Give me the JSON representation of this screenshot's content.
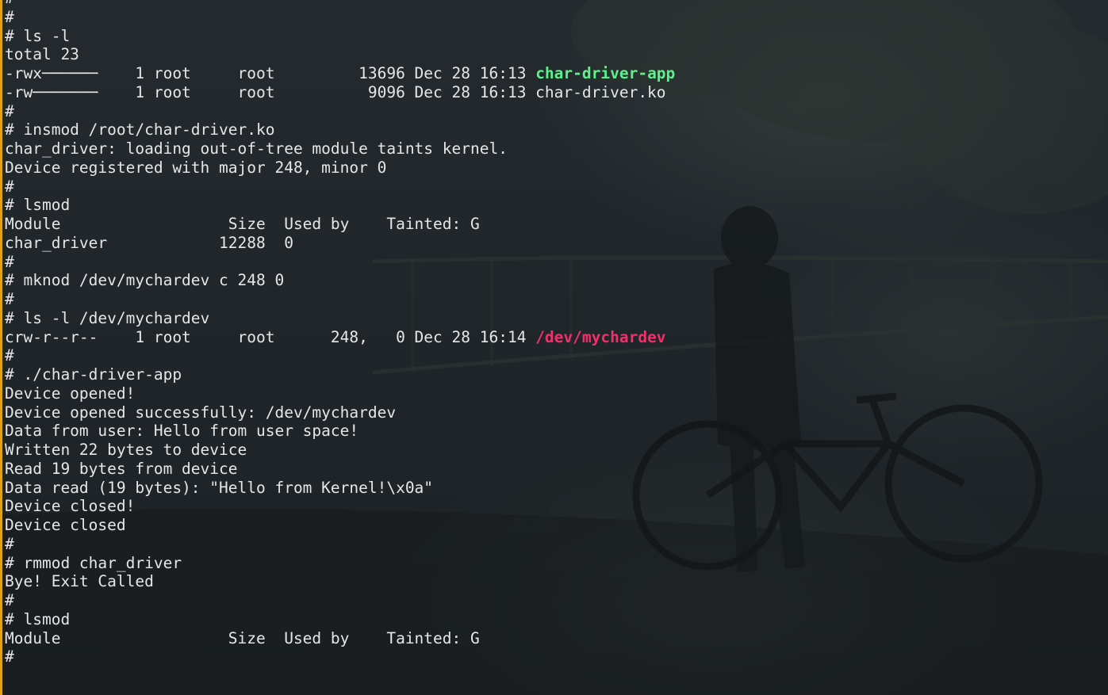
{
  "terminal": {
    "lines": [
      [
        {
          "t": "#"
        }
      ],
      [
        {
          "t": "#"
        }
      ],
      [
        {
          "t": "# ls -l"
        }
      ],
      [
        {
          "t": "total 23"
        }
      ],
      [
        {
          "t": "-rwx──────    1 root     root         13696 Dec 28 16:13 "
        },
        {
          "t": "char-driver-app",
          "c": "green"
        }
      ],
      [
        {
          "t": "-rw───────    1 root     root          9096 Dec 28 16:13 char-driver.ko"
        }
      ],
      [
        {
          "t": "#"
        }
      ],
      [
        {
          "t": "# insmod /root/char-driver.ko"
        }
      ],
      [
        {
          "t": "char_driver: loading out-of-tree module taints kernel."
        }
      ],
      [
        {
          "t": "Device registered with major 248, minor 0"
        }
      ],
      [
        {
          "t": "#"
        }
      ],
      [
        {
          "t": "# lsmod"
        }
      ],
      [
        {
          "t": "Module                  Size  Used by    Tainted: G"
        }
      ],
      [
        {
          "t": "char_driver            12288  0"
        }
      ],
      [
        {
          "t": "#"
        }
      ],
      [
        {
          "t": "# mknod /dev/mychardev c 248 0"
        }
      ],
      [
        {
          "t": "#"
        }
      ],
      [
        {
          "t": "# ls -l /dev/mychardev"
        }
      ],
      [
        {
          "t": "crw-r--r--    1 root     root      248,   0 Dec 28 16:14 "
        },
        {
          "t": "/dev/mychardev",
          "c": "pink"
        }
      ],
      [
        {
          "t": "#"
        }
      ],
      [
        {
          "t": "# ./char-driver-app"
        }
      ],
      [
        {
          "t": "Device opened!"
        }
      ],
      [
        {
          "t": "Device opened successfully: /dev/mychardev"
        }
      ],
      [
        {
          "t": "Data from user: Hello from user space!"
        }
      ],
      [
        {
          "t": "Written 22 bytes to device"
        }
      ],
      [
        {
          "t": "Read 19 bytes from device"
        }
      ],
      [
        {
          "t": "Data read (19 bytes): \"Hello from Kernel!\\x0a\""
        }
      ],
      [
        {
          "t": "Device closed!"
        }
      ],
      [
        {
          "t": "Device closed"
        }
      ],
      [
        {
          "t": "#"
        }
      ],
      [
        {
          "t": "# rmmod char_driver"
        }
      ],
      [
        {
          "t": "Bye! Exit Called"
        }
      ],
      [
        {
          "t": "#"
        }
      ],
      [
        {
          "t": "# lsmod"
        }
      ],
      [
        {
          "t": "Module                  Size  Used by    Tainted: G"
        }
      ],
      [
        {
          "t": "#"
        }
      ]
    ]
  },
  "colors": {
    "border": "#e0a21a",
    "text": "#e6e6e6",
    "executable": "#5ef08a",
    "device_file": "#f0306a"
  }
}
